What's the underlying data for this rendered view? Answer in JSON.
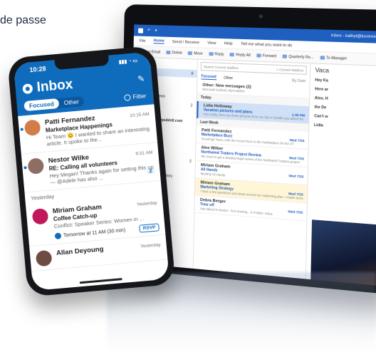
{
  "hero_text": "de passe",
  "tablet": {
    "titlebar_right": "Inbox - kathyt@lucernepubintl.com",
    "menu": [
      "File",
      "Home",
      "Send / Receive",
      "View",
      "Help",
      "Tell me what you want to do"
    ],
    "ribbon": [
      "New Email",
      "Delete",
      "Move",
      "Reply",
      "Reply All",
      "Forward",
      "Quarterly Re...",
      "To Manager"
    ],
    "folders": [
      {
        "label": "Favorites",
        "count": "",
        "head": true
      },
      {
        "label": "Inbox",
        "count": "8",
        "sel": true
      },
      {
        "label": "Sent Items",
        "count": ""
      },
      {
        "label": "Drafts",
        "count": ""
      },
      {
        "label": "Quarterly Reviews",
        "count": ""
      },
      {
        "label": "Deleted Items",
        "count": "2"
      },
      {
        "label": "Marketing",
        "count": ""
      },
      {
        "label": "kathyt@lucernepubintl.com",
        "count": "",
        "head": true
      },
      {
        "label": "Folders",
        "count": "",
        "head": true
      },
      {
        "label": "Inbox",
        "count": "",
        "indent": true
      },
      {
        "label": "Drafts",
        "count": "",
        "indent": true
      },
      {
        "label": "Sent Items",
        "count": "",
        "indent": true
      },
      {
        "label": "Deleted Items",
        "count": "2",
        "indent": true
      },
      {
        "label": "Archive",
        "count": "",
        "indent": true
      },
      {
        "label": "Conversation History",
        "count": "",
        "indent": true
      },
      {
        "label": "Junk Email",
        "count": "",
        "indent": true
      },
      {
        "label": "Outbox",
        "count": "",
        "indent": true
      },
      {
        "label": "Quarterly Reviews",
        "count": "",
        "indent": true
      },
      {
        "label": "RSS Feeds",
        "count": "",
        "indent": true
      },
      {
        "label": "Search Folders",
        "count": "",
        "indent": true
      },
      {
        "label": "Groups",
        "count": "",
        "head": true
      }
    ],
    "search_placeholder": "Search Current Mailbox",
    "mailbox_label": "Current Mailbox",
    "tab_focused": "Focused",
    "tab_other": "Other",
    "by_date": "By Date",
    "other_notice_title": "Other: New messages (2)",
    "other_notice_sub": "Microsoft Outlook; MyAnalytics",
    "groups": {
      "today": "Today",
      "last_week": "Last Week"
    },
    "messages": [
      {
        "from": "Lidia Holloway",
        "subject": "Vacation pictures and plans",
        "preview": "Hey Kathy, here are those pictures from our trip to Seattle you asked for.",
        "date": "1:35 PM",
        "sel": true
      },
      {
        "from": "Patti Fernandez",
        "subject": "Marketplace Buzz",
        "preview": "Greetings Team, with the recent buzz in the marketplace for the XT",
        "date": "Wed 7/25"
      },
      {
        "from": "Alex Wilber",
        "subject": "Northwind Traders Project Review",
        "preview": "We need to get a detailed legal review of the Northwind Traders project",
        "date": "Wed 7/25"
      },
      {
        "from": "Miriam Graham",
        "subject": "All Hands",
        "preview": "Monthly All Hands",
        "date": "Wed 7/25"
      },
      {
        "from": "Miriam Graham",
        "subject": "Marketing Strategy",
        "preview": "I have a few questions and ideas around our marketing plan. I made some",
        "date": "Wed 7/25",
        "flag": true
      },
      {
        "from": "Debra Berger",
        "subject": "Time off",
        "preview": "Just talked to Nestor - he's leaving... In Folder: Inbox",
        "date": "Wed 7/25"
      }
    ],
    "reading": {
      "title": "Vaca",
      "lines": [
        "Hey Ka",
        "Here ar",
        "Also, H",
        "the De",
        "Can't w",
        "Lidia"
      ]
    }
  },
  "phone": {
    "time": "10:28",
    "title": "Inbox",
    "tab_focused": "Focused",
    "tab_other": "Other",
    "filter": "Filter",
    "section_yesterday": "Yesterday",
    "items": [
      {
        "name": "Patti Fernandez",
        "time": "10:15 AM",
        "subject": "Marketplace Happenings",
        "preview": "Hi Team 😊 I wanted to share an interesting article. It spoke to the...",
        "unread": true,
        "color": "#d27d48"
      },
      {
        "name": "Nestor Wilke",
        "time": "9:31 AM",
        "subject": "RE: Calling all volunteers",
        "preview": "Hey Megan! Thanks again for setting this up — @Adele has also ...",
        "unread": true,
        "count": "2",
        "color": "#8d6e63"
      },
      {
        "name": "Miriam Graham",
        "time": "Yesterday",
        "subject": "Coffee Catch-up",
        "preview": "Conflict: Speaker Series: Women in ...",
        "event": "Tomorrow at 11 AM (30 min)",
        "rsvp": "RSVP",
        "color": "#c2185b"
      },
      {
        "name": "Allan Deyoung",
        "time": "Yesterday",
        "subject": "",
        "preview": "",
        "color": "#6d4c41"
      }
    ]
  }
}
